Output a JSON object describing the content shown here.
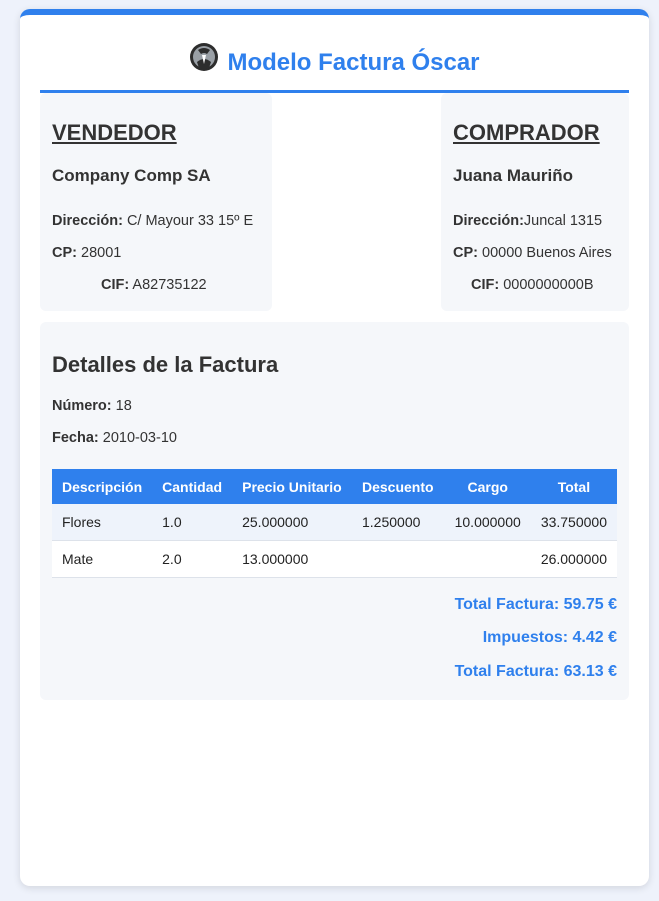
{
  "header": {
    "title": "Modelo Factura Óscar",
    "logo_icon": "person-circle-logo"
  },
  "seller": {
    "heading": "VENDEDOR",
    "name": "Company Comp SA",
    "address_label": "Dirección:",
    "address": " C/ Mayour 33 15º E",
    "cp_label": "CP:",
    "cp": " 28001",
    "cif_label": "CIF:",
    "cif": " A82735122"
  },
  "buyer": {
    "heading": "COMPRADOR",
    "name": "Juana Mauriño",
    "address_label": "Dirección:",
    "address": "Juncal 1315",
    "cp_label": "CP:",
    "cp": " 00000 Buenos Aires",
    "cif_label": "CIF:",
    "cif": " 0000000000B"
  },
  "details": {
    "heading": "Detalles de la Factura",
    "number_label": "Número:",
    "number": " 18",
    "date_label": "Fecha:",
    "date": " 2010-03-10"
  },
  "table": {
    "headers": [
      "Descripción",
      "Cantidad",
      "Precio Unitario",
      "Descuento",
      "Cargo",
      "Total"
    ],
    "rows": [
      [
        "Flores",
        "1.0",
        "25.000000",
        "1.250000",
        "10.000000",
        "33.750000"
      ],
      [
        "Mate",
        "2.0",
        "13.000000",
        "",
        "",
        "26.000000"
      ]
    ]
  },
  "totals": {
    "subtotal": "Total Factura: 59.75 €",
    "taxes": "Impuestos: 4.42 €",
    "total": "Total Factura: 63.13 €"
  },
  "colors": {
    "accent": "#2f80ed",
    "panel": "#f5f7fa"
  }
}
